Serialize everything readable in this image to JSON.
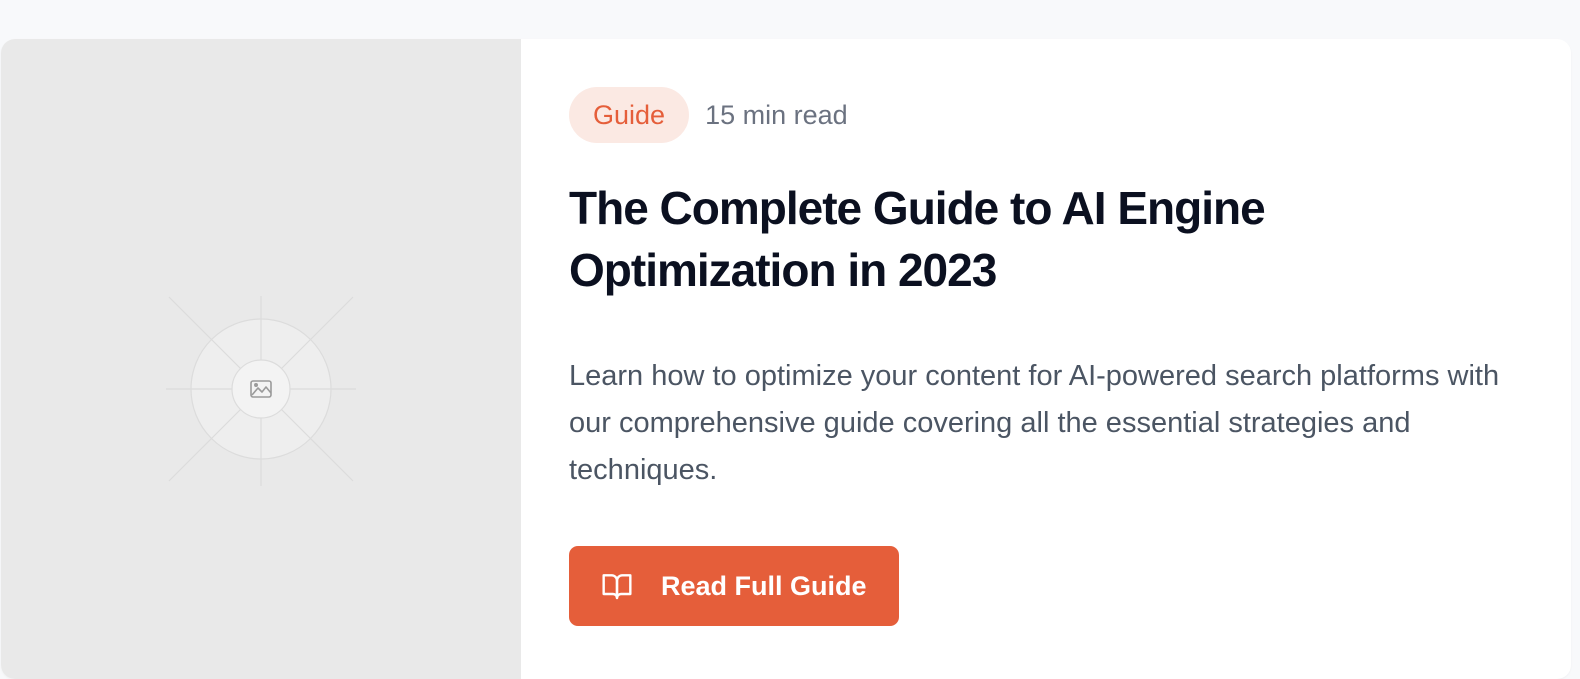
{
  "card": {
    "image": {
      "icon": "image-placeholder-icon",
      "background": "#e9e9e9"
    },
    "badge": "Guide",
    "read_time": "15 min read",
    "title": "The Complete Guide to AI Engine Optimization in 2023",
    "description": "Learn how to optimize your content for AI-powered search platforms with our comprehensive guide covering all the essential strategies and techniques.",
    "cta": {
      "label": "Read Full Guide",
      "icon": "book-open-icon"
    }
  },
  "colors": {
    "accent": "#e55e3a",
    "badge_bg": "#fbe9e3",
    "title": "#0b1020",
    "body": "#4b5563",
    "muted": "#6b7280"
  }
}
